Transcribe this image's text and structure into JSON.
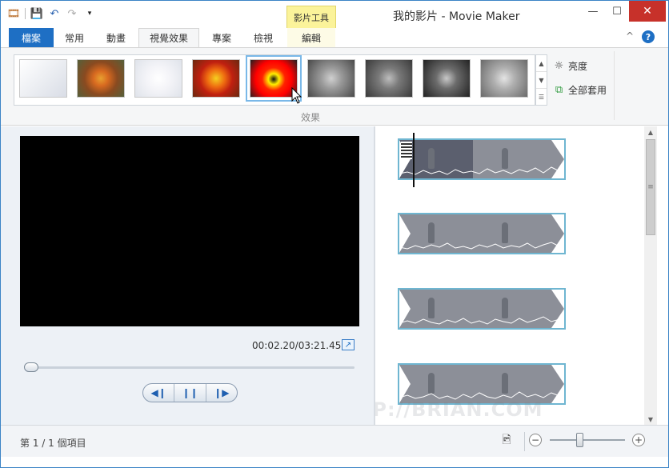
{
  "window": {
    "title": "我的影片 - Movie Maker",
    "context_tab": "影片工具",
    "minimize": "—",
    "maximize": "☐",
    "close": "✕"
  },
  "qat": {
    "app_icon": "film-icon",
    "save_icon": "save-icon",
    "undo_icon": "undo-icon",
    "redo_icon": "redo-icon",
    "customize_icon": "dropdown-icon"
  },
  "tabs": [
    {
      "label": "檔案"
    },
    {
      "label": "常用"
    },
    {
      "label": "動畫"
    },
    {
      "label": "視覺效果"
    },
    {
      "label": "專案"
    },
    {
      "label": "檢視"
    },
    {
      "label": "編輯"
    }
  ],
  "ribbon": {
    "group_label": "效果",
    "brightness_label": "亮度",
    "apply_all_label": "全部套用",
    "help": "?",
    "collapse": "^",
    "effects": [
      {
        "name": "none",
        "selected": false
      },
      {
        "name": "warm",
        "selected": false
      },
      {
        "name": "edge",
        "selected": false
      },
      {
        "name": "posterize",
        "selected": false
      },
      {
        "name": "threshold",
        "selected": true
      },
      {
        "name": "grayscale",
        "selected": false
      },
      {
        "name": "grayscale-dark",
        "selected": false
      },
      {
        "name": "grayscale-contrast",
        "selected": false
      },
      {
        "name": "grayscale-light",
        "selected": false
      }
    ]
  },
  "preview": {
    "timecode": "00:02.20/03:21.45",
    "seek_progress": 0.01,
    "prev_frame": "◀❙",
    "pause": "❙❙",
    "next_frame": "❙▶"
  },
  "status": {
    "text": "第 1 / 1 個項目",
    "zoom_out": "−",
    "zoom_in": "+",
    "zoom_level": 0.4
  },
  "watermark": "HTTP://BRIAN.COM",
  "colors": {
    "accent": "#1e6fc4",
    "clip_border": "#6fb6d1",
    "close": "#c7312a",
    "context_tab": "#fbf39a"
  }
}
